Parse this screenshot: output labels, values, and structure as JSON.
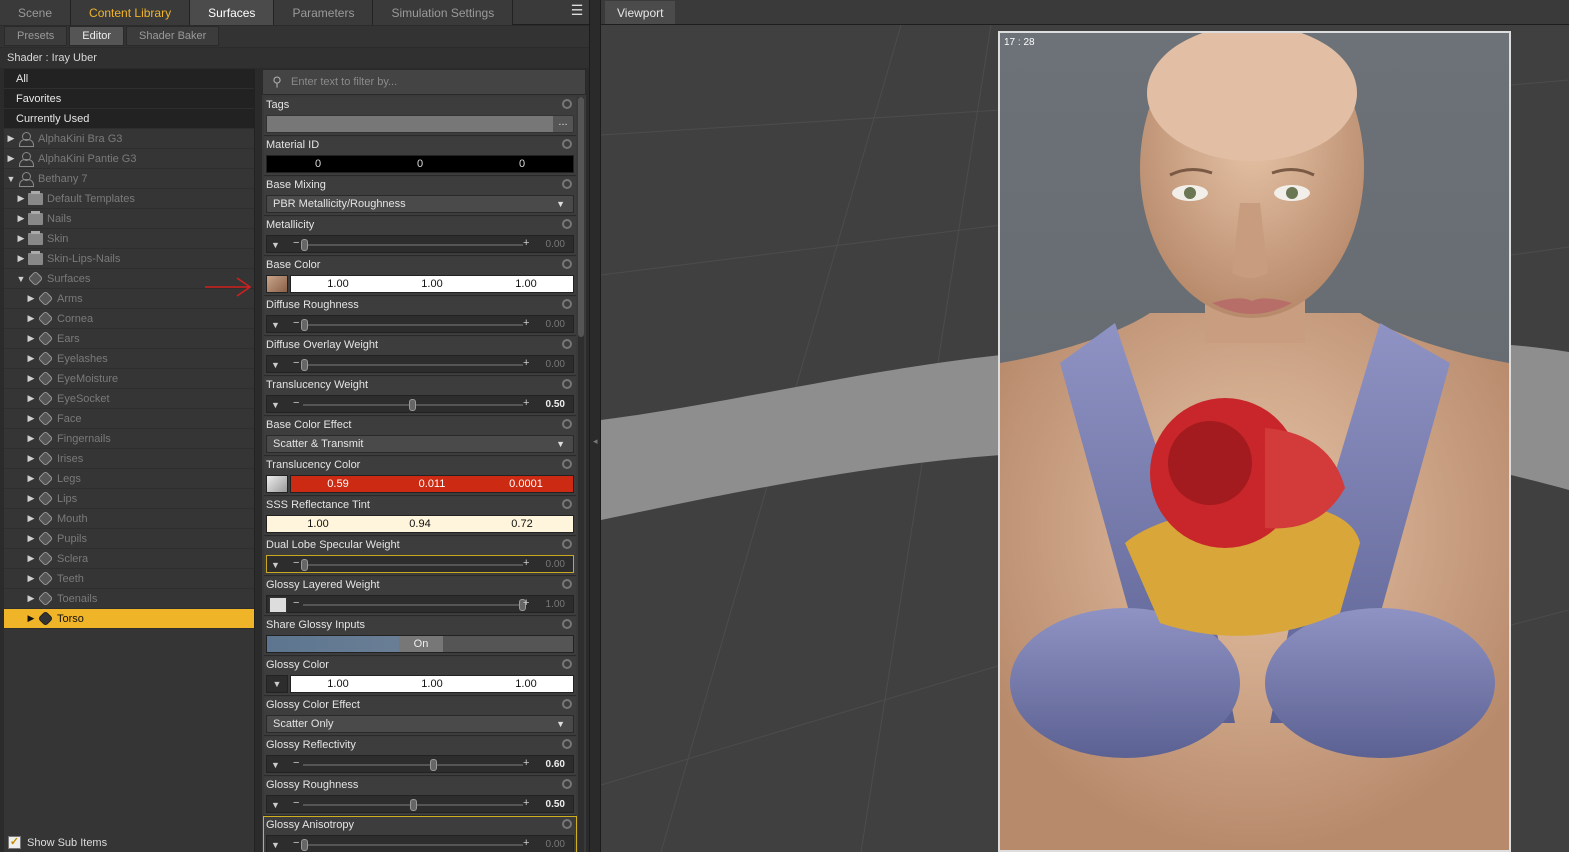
{
  "top_tabs": [
    "Scene",
    "Content Library",
    "Surfaces",
    "Parameters",
    "Simulation Settings"
  ],
  "sub_tabs": [
    "Presets",
    "Editor",
    "Shader Baker"
  ],
  "shader_label": "Shader : Iray Uber",
  "tree": {
    "top_items": [
      "All",
      "Favorites",
      "Currently Used"
    ],
    "items": [
      "AlphaKini Bra G3",
      "AlphaKini Pantie G3",
      "Bethany 7",
      "Default Templates",
      "Nails",
      "Skin",
      "Skin-Lips-Nails",
      "Surfaces",
      "Arms",
      "Cornea",
      "Ears",
      "Eyelashes",
      "EyeMoisture",
      "EyeSocket",
      "Face",
      "Fingernails",
      "Irises",
      "Legs",
      "Lips",
      "Mouth",
      "Pupils",
      "Sclera",
      "Teeth",
      "Toenails",
      "Torso"
    ],
    "show_sub_items": "Show Sub Items"
  },
  "filter_placeholder": "Enter text to filter by...",
  "properties": {
    "tags": {
      "label": "Tags",
      "more": "..."
    },
    "material_id": {
      "label": "Material ID",
      "values": [
        "0",
        "0",
        "0"
      ]
    },
    "base_mixing": {
      "label": "Base Mixing",
      "value": "PBR Metallicity/Roughness"
    },
    "metallicity": {
      "label": "Metallicity",
      "value": "0.00"
    },
    "base_color": {
      "label": "Base Color",
      "values": [
        "1.00",
        "1.00",
        "1.00"
      ]
    },
    "diffuse_roughness": {
      "label": "Diffuse Roughness",
      "value": "0.00"
    },
    "diffuse_overlay_weight": {
      "label": "Diffuse Overlay Weight",
      "value": "0.00"
    },
    "translucency_weight": {
      "label": "Translucency Weight",
      "value": "0.50"
    },
    "base_color_effect": {
      "label": "Base Color Effect",
      "value": "Scatter & Transmit"
    },
    "translucency_color": {
      "label": "Translucency Color",
      "values": [
        "0.59",
        "0.011",
        "0.0001"
      ]
    },
    "sss_reflectance_tint": {
      "label": "SSS Reflectance Tint",
      "values": [
        "1.00",
        "0.94",
        "0.72"
      ]
    },
    "dual_lobe_specular_weight": {
      "label": "Dual Lobe Specular Weight",
      "value": "0.00"
    },
    "glossy_layered_weight": {
      "label": "Glossy Layered Weight",
      "value": "1.00"
    },
    "share_glossy_inputs": {
      "label": "Share Glossy Inputs",
      "value": "On"
    },
    "glossy_color": {
      "label": "Glossy Color",
      "values": [
        "1.00",
        "1.00",
        "1.00"
      ]
    },
    "glossy_color_effect": {
      "label": "Glossy Color Effect",
      "value": "Scatter Only"
    },
    "glossy_reflectivity": {
      "label": "Glossy Reflectivity",
      "value": "0.60"
    },
    "glossy_roughness": {
      "label": "Glossy Roughness",
      "value": "0.50"
    },
    "glossy_anisotropy": {
      "label": "Glossy Anisotropy",
      "value": "0.00"
    }
  },
  "viewport": {
    "tab": "Viewport",
    "timer": "17 : 28"
  }
}
